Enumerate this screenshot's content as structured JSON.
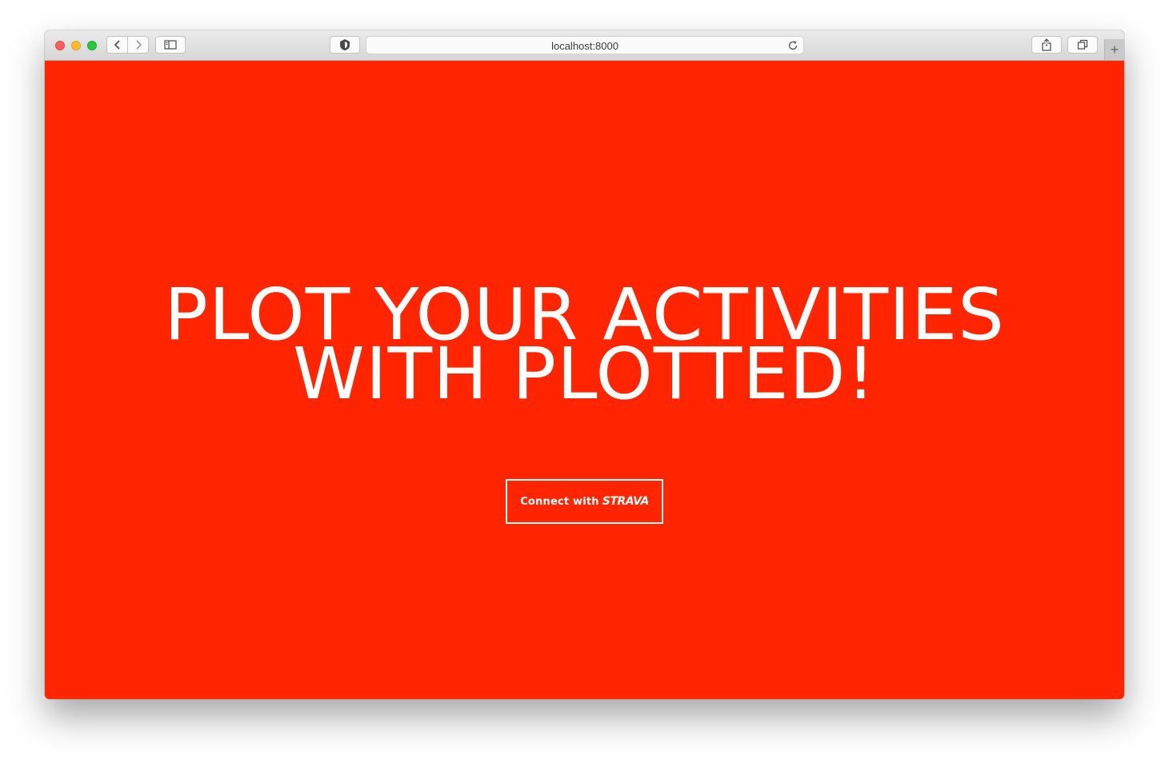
{
  "browser": {
    "address": "localhost:8000",
    "new_tab_symbol": "+"
  },
  "page": {
    "background_color": "#fe2500",
    "headline_line1": "PLOT YOUR ACTIVITIES",
    "headline_line2": "WITH PLOTTED!",
    "connect_button": {
      "label": "Connect with",
      "brand": "STRAVA"
    }
  },
  "icons": [
    "back-icon",
    "forward-icon",
    "sidebar-icon",
    "privacy-shield-icon",
    "reload-icon",
    "share-icon",
    "tabs-overview-icon",
    "new-tab-icon"
  ]
}
